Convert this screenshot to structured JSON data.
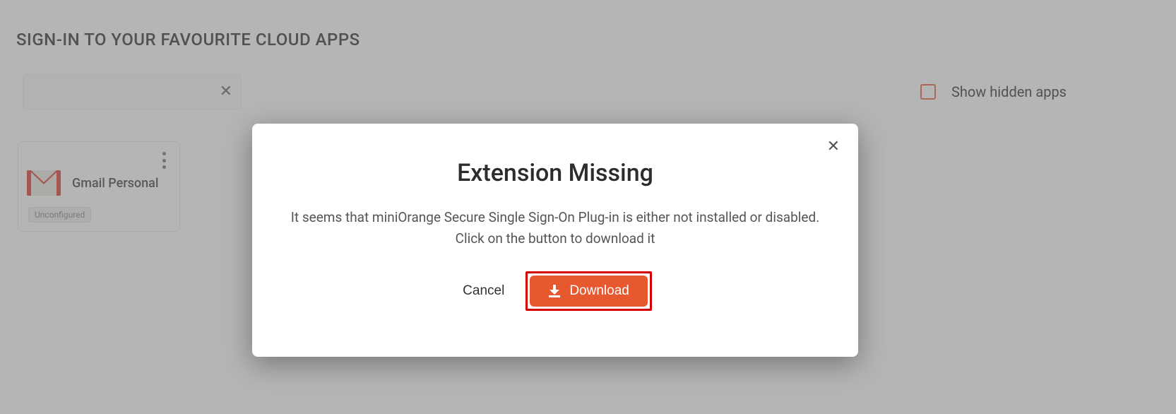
{
  "page": {
    "title": "SIGN-IN TO YOUR FAVOURITE CLOUD APPS"
  },
  "search": {
    "value": "",
    "placeholder": ""
  },
  "toolbar": {
    "show_hidden_label": "Show hidden apps",
    "show_hidden_checked": false
  },
  "apps": [
    {
      "name": "Gmail Personal",
      "status": "Unconfigured",
      "icon": "gmail"
    }
  ],
  "modal": {
    "title": "Extension Missing",
    "body_line1": "It seems that miniOrange Secure Single Sign-On Plug-in is either not installed or disabled.",
    "body_line2": "Click on the button to download it",
    "cancel_label": "Cancel",
    "download_label": "Download"
  },
  "colors": {
    "accent": "#e7582f",
    "highlight_border": "#d40000"
  }
}
